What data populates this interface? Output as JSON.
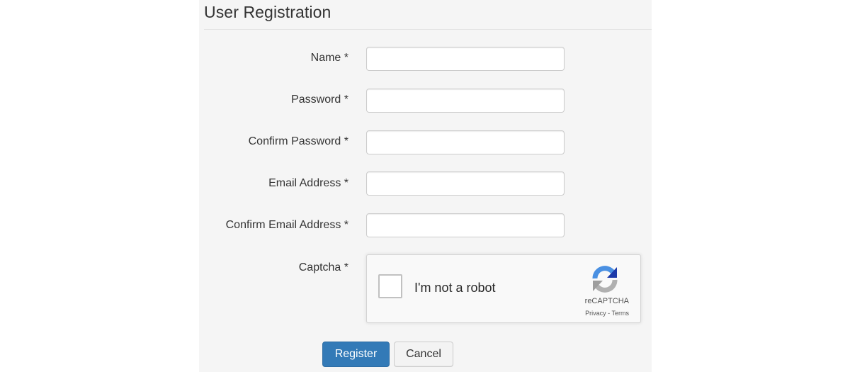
{
  "page": {
    "title": "User Registration"
  },
  "form": {
    "fields": [
      {
        "label": "Name *",
        "value": "",
        "placeholder": ""
      },
      {
        "label": "Password *",
        "value": "",
        "placeholder": ""
      },
      {
        "label": "Confirm Password *",
        "value": "",
        "placeholder": ""
      },
      {
        "label": "Email Address *",
        "value": "",
        "placeholder": ""
      },
      {
        "label": "Confirm Email Address *",
        "value": "",
        "placeholder": ""
      }
    ],
    "captcha_label": "Captcha *"
  },
  "recaptcha": {
    "checkbox_label": "I'm not a robot",
    "checked": false,
    "brand": "reCAPTCHA",
    "privacy": "Privacy",
    "separator": " - ",
    "terms": "Terms",
    "logo_icon": "recaptcha-logo-icon"
  },
  "buttons": {
    "register": "Register",
    "cancel": "Cancel"
  },
  "colors": {
    "primary": "#337ab7",
    "panel_background": "#f5f5f5",
    "recaptcha_blue": "#4a90e2"
  }
}
